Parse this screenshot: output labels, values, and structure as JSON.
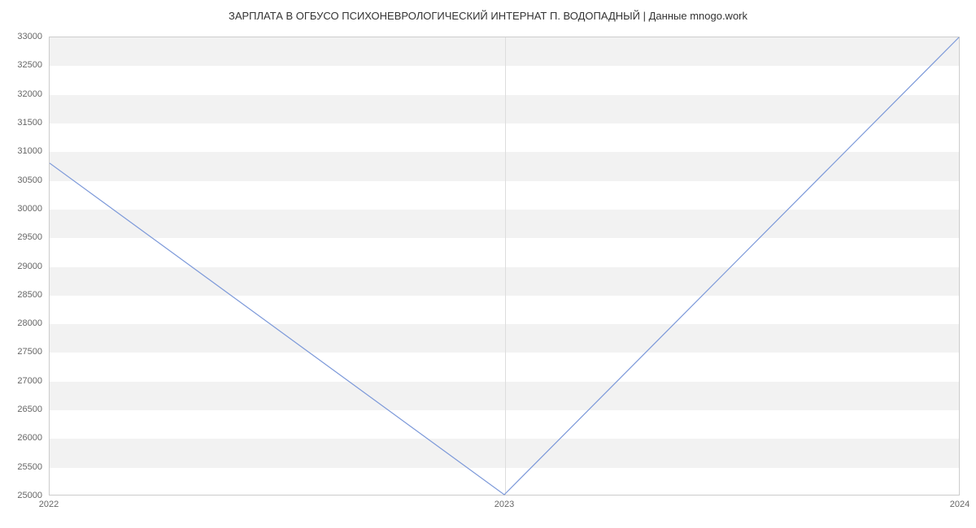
{
  "chart_data": {
    "type": "line",
    "title": "ЗАРПЛАТА В ОГБУСО ПСИХОНЕВРОЛОГИЧЕСКИЙ ИНТЕРНАТ П. ВОДОПАДНЫЙ | Данные mnogo.work",
    "x": [
      2022,
      2023,
      2024
    ],
    "values": [
      30800,
      25000,
      33000
    ],
    "xlabel": "",
    "ylabel": "",
    "ylim": [
      25000,
      33000
    ],
    "xlim": [
      2022,
      2024
    ],
    "y_ticks": [
      25000,
      25500,
      26000,
      26500,
      27000,
      27500,
      28000,
      28500,
      29000,
      29500,
      30000,
      30500,
      31000,
      31500,
      32000,
      32500,
      33000
    ],
    "x_ticks": [
      2022,
      2023,
      2024
    ],
    "line_color": "#7B98D9",
    "band_color": "#f2f2f2"
  }
}
